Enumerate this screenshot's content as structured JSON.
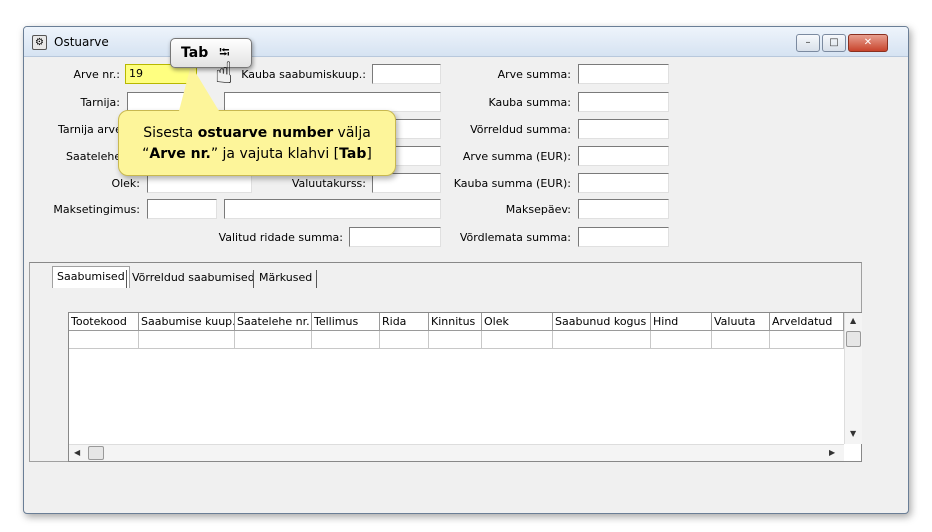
{
  "window": {
    "title": "Ostuarve",
    "icon": "app-gear-icon",
    "controls": {
      "minimize": "–",
      "maximize": "□",
      "close": "✕"
    }
  },
  "form": {
    "arve_nr": {
      "label": "Arve nr.:",
      "value": "19"
    },
    "tarnija": {
      "label": "Tarnija:",
      "value": ""
    },
    "tarnija_arve": {
      "label": "Tarnija arve",
      "value": ""
    },
    "saatelehe": {
      "label": "Saatelehe",
      "value": ""
    },
    "olek": {
      "label": "Olek:",
      "value": ""
    },
    "maksetingimus": {
      "label": "Maksetingimus:",
      "value": ""
    },
    "kauba_saabumiskuup": {
      "label": "Kauba saabumiskuup.:",
      "value": ""
    },
    "valuutakurss": {
      "label": "Valuutakurss:",
      "value": ""
    },
    "valitud_ridade_summa": {
      "label": "Valitud ridade summa:",
      "value": ""
    },
    "arve_summa": {
      "label": "Arve summa:",
      "value": ""
    },
    "kauba_summa": {
      "label": "Kauba summa:",
      "value": ""
    },
    "vorreldud_summa": {
      "label": "Võrreldud summa:",
      "value": ""
    },
    "arve_summa_eur": {
      "label": "Arve summa (EUR):",
      "value": ""
    },
    "kauba_summa_eur": {
      "label": "Kauba summa (EUR):",
      "value": ""
    },
    "maksepaev": {
      "label": "Maksepäev:",
      "value": ""
    },
    "vordlemata_summa": {
      "label": "Võrdlemata summa:",
      "value": ""
    }
  },
  "tabs": [
    {
      "label": "Saabumised"
    },
    {
      "label": "Võrreldud saabumised"
    },
    {
      "label": "Märkused"
    }
  ],
  "grid": {
    "columns": [
      "Tootekood",
      "Saabumise kuup.",
      "Saatelehe nr.",
      "Tellimus",
      "Rida",
      "Kinnitus",
      "Olek",
      "Saabunud kogus",
      "Hind",
      "Valuuta",
      "Arveldatud"
    ]
  },
  "callout": {
    "line1_pre": "Sisesta ",
    "line1_bold": "ostuarve number",
    "line1_post": " välja",
    "line2_pre": "“",
    "line2_bold": "Arve nr.",
    "line2_mid": "” ja vajuta klahvi [",
    "line2_key": "Tab",
    "line2_end": "]"
  },
  "tab_key": {
    "label": "Tab",
    "arrow": "⭾"
  }
}
